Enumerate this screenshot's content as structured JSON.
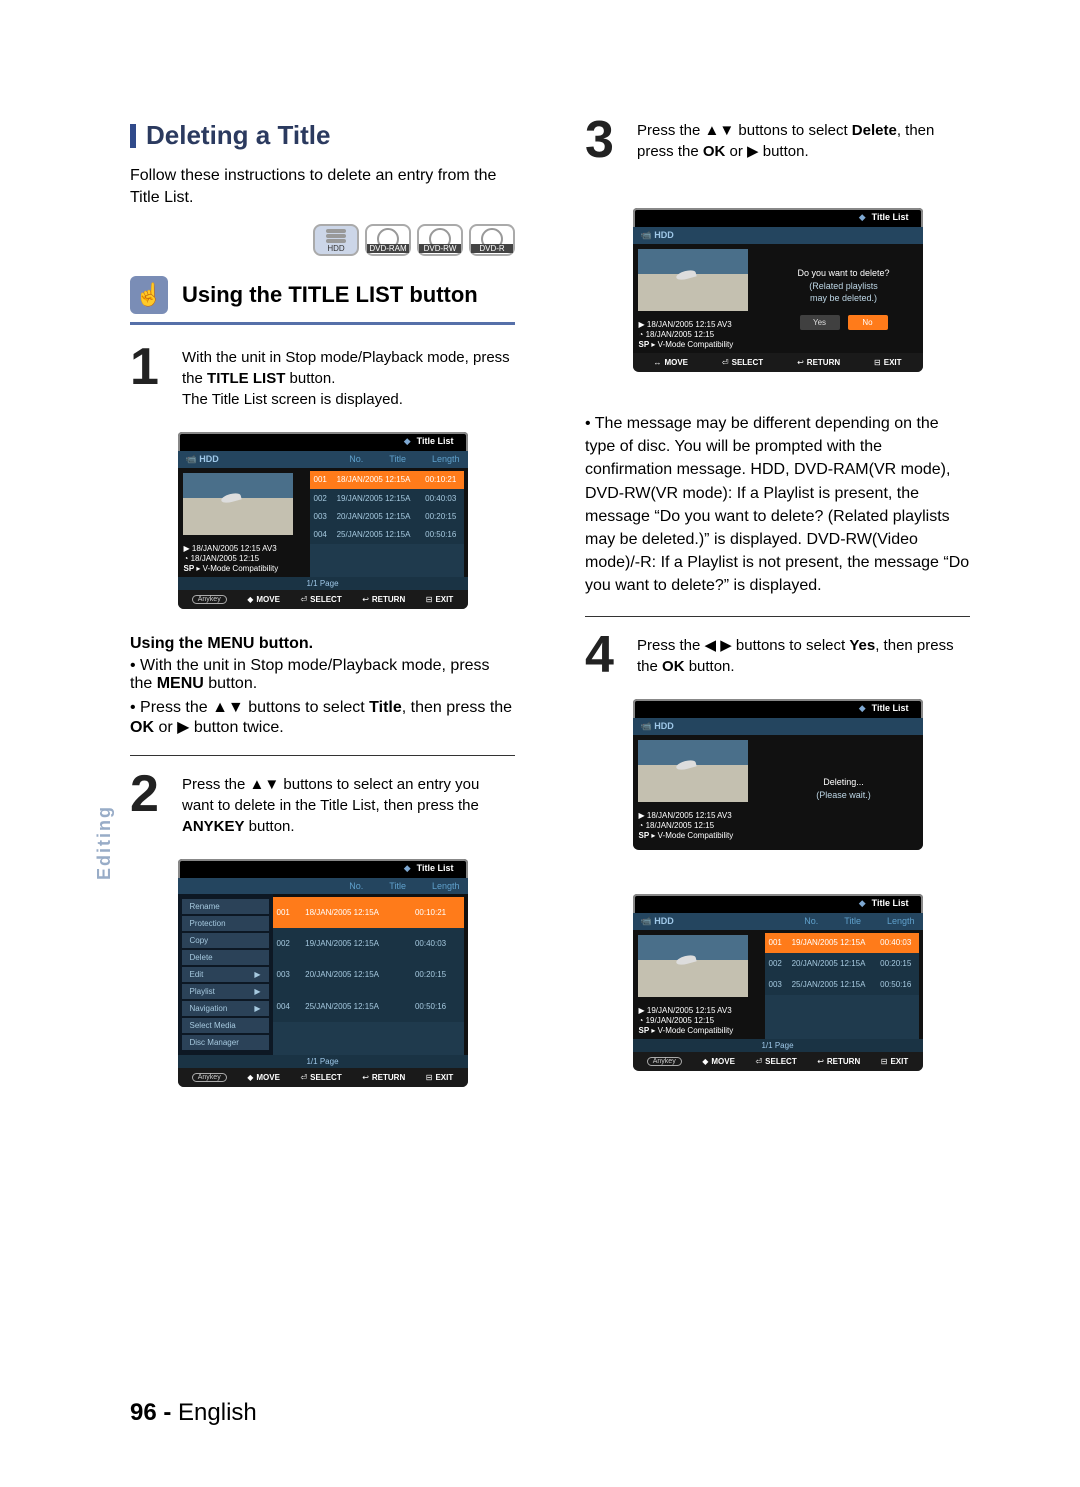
{
  "header": {
    "title": "Deleting a Title"
  },
  "intro": "Follow these instructions to delete an entry from the Title List.",
  "discs": [
    {
      "label": "HDD",
      "kind": "stack"
    },
    {
      "label": "DVD-RAM",
      "kind": "disc"
    },
    {
      "label": "DVD-RW",
      "kind": "disc"
    },
    {
      "label": "DVD-R",
      "kind": "disc"
    }
  ],
  "subtitle": "Using the TITLE LIST button",
  "steps_left": [
    {
      "num": "1",
      "before": "With the unit in Stop mode/Playback mode, press the ",
      "bold": "TITLE LIST",
      "after": " button.\nThe Title List screen is displayed."
    },
    {
      "num": "2",
      "before": "Press the ▲▼ buttons to select an entry you want to delete in the Title List, then press the ",
      "bold": "ANYKEY",
      "after": " button."
    }
  ],
  "using_menu_heading": "Using the MENU button.",
  "using_menu_items": [
    "With the unit in Stop mode/Playback mode, press the MENU button.",
    "Press the ▲▼ buttons to select Title, then press the OK or ▶ button twice."
  ],
  "steps_right": [
    {
      "num": "3",
      "text": "Press the ▲▼ buttons to select Delete, then press the OK or ▶ button."
    },
    {
      "num": "4",
      "text": "Press the ◀ ▶ buttons to select Yes, then press the OK button."
    }
  ],
  "right_note_bullet": "The message may be different depending on the type of disc. You will be prompted with the confirmation message. HDD, DVD-RAM(VR mode), DVD-RW(VR mode): If a Playlist is present, the message “Do you want to delete? (Related playlists may be deleted.)” is displayed. DVD-RW(Video mode)/-R: If a Playlist is not present, the message “Do you want to delete?” is displayed.",
  "osd_common": {
    "title_list": "Title List",
    "hdd": "HDD",
    "no": "No.",
    "title_col": "Title",
    "length": "Length",
    "page": "1/1 Page",
    "play_icon": "▶",
    "clock_icon": "◔",
    "info_date1": "18/JAN/2005 12:15 AV3",
    "info_date2": "18/JAN/2005 12:15",
    "info_sp": "SP",
    "info_vmode": "V-Mode Compatibility",
    "anykey": "Anykey",
    "move": "MOVE",
    "select": "SELECT",
    "return": "RETURN",
    "exit": "EXIT",
    "move_sym": "◆",
    "move_sym2": "↔",
    "sel_sym": "⏎",
    "ret_sym": "↩",
    "exit_sym": "⊟"
  },
  "osd_list_rows": [
    {
      "no": "001",
      "title": "18/JAN/2005 12:15A",
      "len": "00:10:21",
      "hi": true
    },
    {
      "no": "002",
      "title": "19/JAN/2005 12:15A",
      "len": "00:40:03"
    },
    {
      "no": "003",
      "title": "20/JAN/2005 12:15A",
      "len": "00:20:15"
    },
    {
      "no": "004",
      "title": "25/JAN/2005 12:15A",
      "len": "00:50:16"
    }
  ],
  "osd_menu_items": [
    {
      "label": "Rename",
      "arrow": ""
    },
    {
      "label": "Protection",
      "arrow": ""
    },
    {
      "label": "Copy",
      "arrow": ""
    },
    {
      "label": "Delete",
      "arrow": ""
    },
    {
      "label": "Edit",
      "arrow": "▶"
    },
    {
      "label": "Playlist",
      "arrow": "▶"
    },
    {
      "label": "Navigation",
      "arrow": "▶"
    },
    {
      "label": "Select Media",
      "arrow": ""
    },
    {
      "label": "Disc Manager",
      "arrow": ""
    }
  ],
  "osd_confirm": {
    "line1": "Do you want to delete?",
    "line2": "(Related playlists",
    "line3": "may be deleted.)",
    "yes": "Yes",
    "no": "No"
  },
  "osd_deleting": {
    "line1": "Deleting...",
    "line2": "(Please wait.)"
  },
  "osd_after_rows": [
    {
      "no": "001",
      "title": "19/JAN/2005 12:15A",
      "len": "00:40:03",
      "hi": true
    },
    {
      "no": "002",
      "title": "20/JAN/2005 12:15A",
      "len": "00:20:15"
    },
    {
      "no": "003",
      "title": "25/JAN/2005 12:15A",
      "len": "00:50:16"
    }
  ],
  "osd_after_info_date1": "19/JAN/2005 12:15 AV3",
  "osd_after_info_date2": "19/JAN/2005 12:15",
  "side_tab": "Editing",
  "page_number": "96 -",
  "page_lang": "English"
}
